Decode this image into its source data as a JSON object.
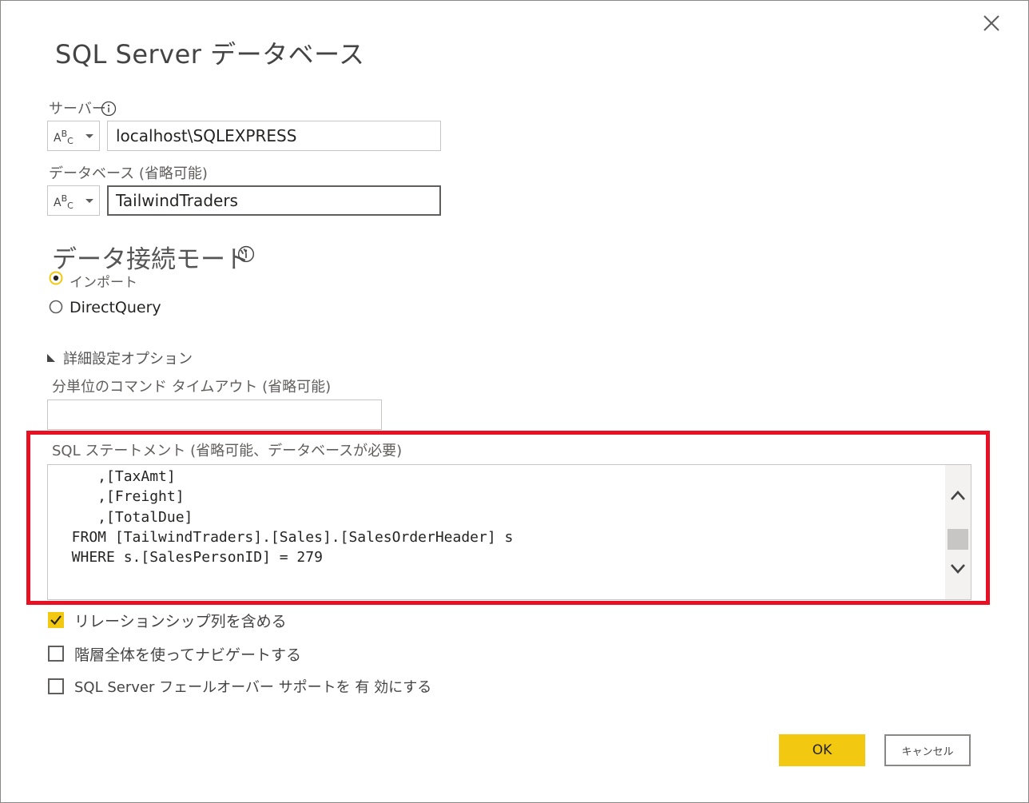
{
  "dialog": {
    "title": "SQL  Server データベース",
    "close_icon": "close-icon"
  },
  "server": {
    "label": "サーバー",
    "type_icon": "abc-text-type-icon",
    "value": "localhost\\SQLEXPRESS"
  },
  "database": {
    "label": "データベース (省略可能)",
    "type_icon": "abc-text-type-icon",
    "value": "TailwindTraders"
  },
  "connectivity": {
    "title": "データ接続モード",
    "options": [
      {
        "label": "インポート",
        "selected": true
      },
      {
        "label": "DirectQuery",
        "selected": false
      }
    ]
  },
  "advanced": {
    "toggle_label": "詳細設定オプション",
    "timeout_label": "分単位のコマンド タイムアウト (省略可能)",
    "timeout_value": "",
    "sql_label": "SQL ステートメント (省略可能、データベースが必要)",
    "sql_lines": [
      "     ,[       ]",
      "     ,[TaxAmt]",
      "     ,[Freight]",
      "     ,[TotalDue]",
      "  FROM [TailwindTraders].[Sales].[SalesOrderHeader] s",
      "  WHERE s.[SalesPersonID] = 279"
    ],
    "checkboxes": [
      {
        "label": "リレーションシップ列を含める",
        "checked": true
      },
      {
        "label": "階層全体を使ってナビゲートする",
        "checked": false
      },
      {
        "label": "SQL  Server フェールオーバー サポートを 有 効にする",
        "checked": false
      }
    ]
  },
  "buttons": {
    "ok": "OK",
    "cancel": "キャンセル"
  },
  "colors": {
    "accent": "#f2c811",
    "highlight": "#e81123"
  }
}
